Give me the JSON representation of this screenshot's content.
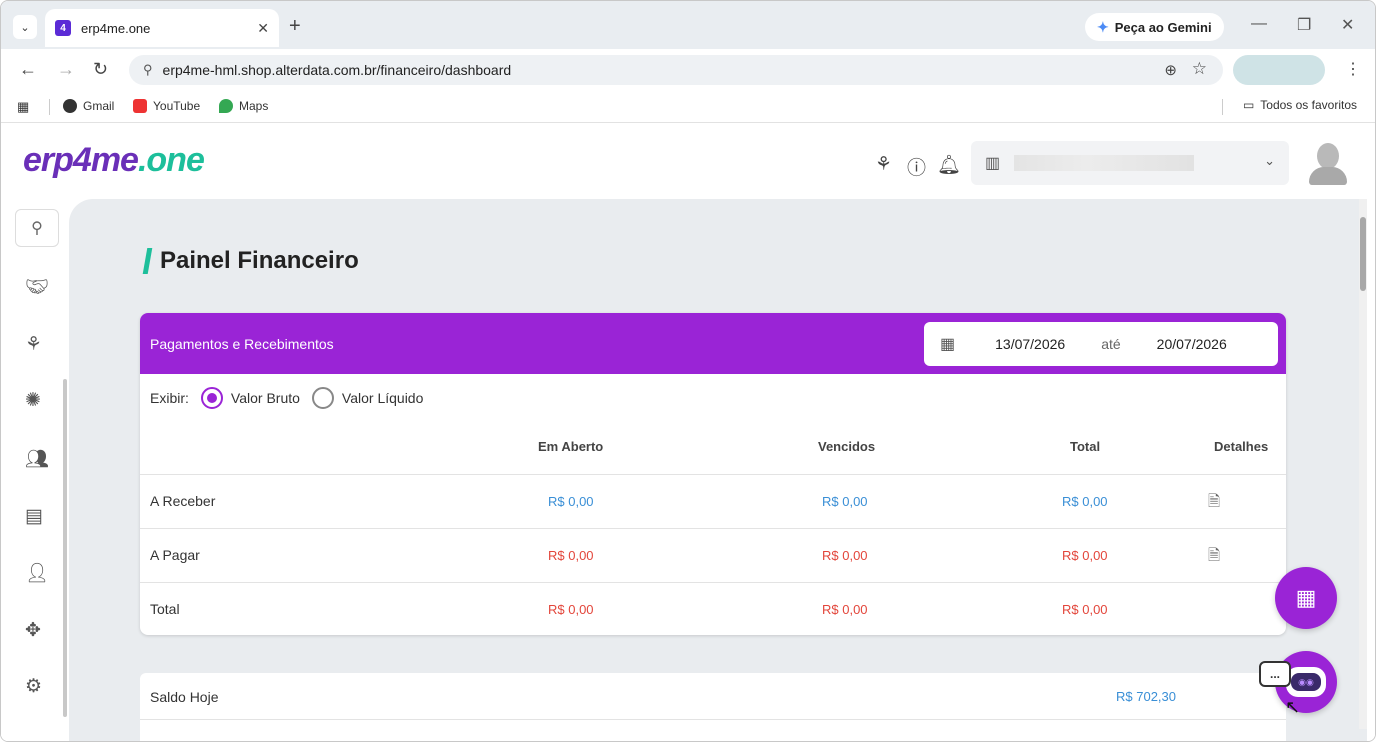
{
  "browser": {
    "tab_title": "erp4me.one",
    "tab_favicon": "4",
    "gemini_label": "Peça ao Gemini",
    "url_site_icon": "⚲",
    "url": "erp4me-hml.shop.alterdata.com.br/financeiro/dashboard",
    "bookmarks": [
      {
        "label": "Gmail"
      },
      {
        "label": "YouTube"
      },
      {
        "label": "Maps"
      }
    ],
    "all_bookmarks_label": "Todos os favoritos"
  },
  "app": {
    "logo_part1": "erp4me",
    "logo_part2": ".one",
    "page_title": "Painel Financeiro",
    "accent_color": "#9a24d6",
    "brand_green": "#1dbf9b"
  },
  "payments_card": {
    "title": "Pagamentos e Recebimentos",
    "date_start": "13/07/2026",
    "date_until_label": "até",
    "date_end": "20/07/2026",
    "show_label": "Exibir:",
    "option_gross": "Valor Bruto",
    "option_net": "Valor Líquido",
    "selected_option": "Valor Bruto",
    "columns": {
      "open": "Em Aberto",
      "overdue": "Vencidos",
      "total": "Total",
      "details": "Detalhes"
    },
    "rows": [
      {
        "label": "A Receber",
        "open": "R$ 0,00",
        "overdue": "R$ 0,00",
        "total": "R$ 0,00"
      },
      {
        "label": "A Pagar",
        "open": "R$ 0,00",
        "overdue": "R$ 0,00",
        "total": "R$ 0,00"
      },
      {
        "label": "Total",
        "open": "R$ 0,00",
        "overdue": "R$ 0,00",
        "total": "R$ 0,00"
      }
    ]
  },
  "balance_card": {
    "label": "Saldo Hoje",
    "value": "R$ 702,30"
  },
  "chat_bubble": "..."
}
